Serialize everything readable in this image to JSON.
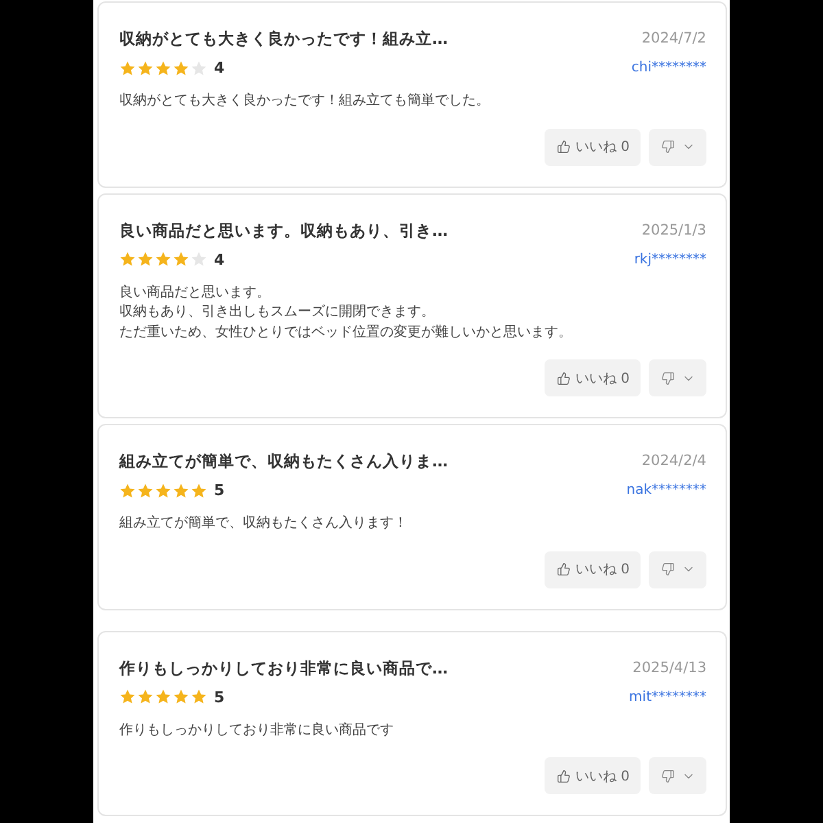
{
  "reviews": [
    {
      "title": "収納がとても大きく良かったです！組み立…",
      "date": "2024/7/2",
      "stars": 4,
      "rating": "4",
      "user": "chi********",
      "body": [
        "収納がとても大きく良かったです！組み立ても簡単でした。"
      ],
      "like_button": {
        "label": "いいね 0"
      }
    },
    {
      "title": "良い商品だと思います。収納もあり、引き…",
      "date": "2025/1/3",
      "stars": 4,
      "rating": "4",
      "user": "rkj********",
      "body": [
        "良い商品だと思います。",
        "収納もあり、引き出しもスムーズに開閉できます。",
        "ただ重いため、女性ひとりではベッド位置の変更が難しいかと思います。"
      ],
      "like_button": {
        "label": "いいね 0"
      }
    },
    {
      "title": "組み立てが簡単で、収納もたくさん入りま…",
      "date": "2024/2/4",
      "stars": 5,
      "rating": "5",
      "user": "nak********",
      "body": [
        "組み立てが簡単で、収納もたくさん入ります！"
      ],
      "like_button": {
        "label": "いいね 0"
      }
    },
    {
      "title": "作りもしっかりしており非常に良い商品で…",
      "date": "2025/4/13",
      "stars": 5,
      "rating": "5",
      "user": "mit********",
      "body": [
        "作りもしっかりしており非常に良い商品です"
      ],
      "like_button": {
        "label": "いいね 0"
      }
    }
  ]
}
